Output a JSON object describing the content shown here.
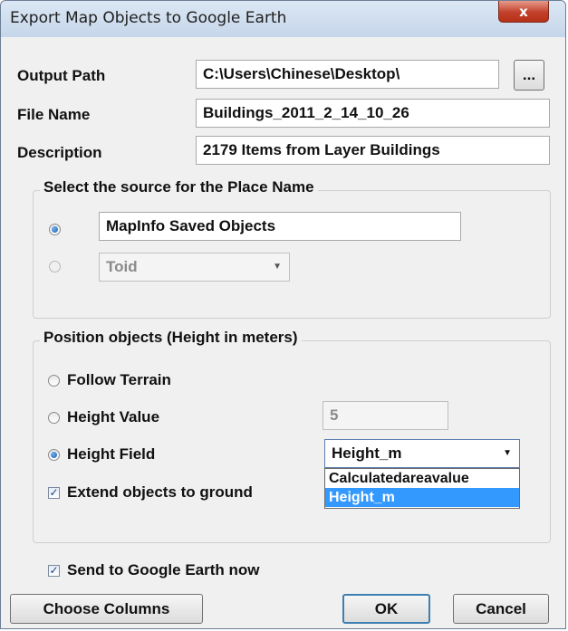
{
  "window": {
    "title": "Export Map Objects to Google Earth",
    "close_glyph": "x"
  },
  "output_path": {
    "label": "Output Path",
    "value": "C:\\Users\\Chinese\\Desktop\\",
    "browse_label": "..."
  },
  "file_name": {
    "label": "File Name",
    "value": "Buildings_2011_2_14_10_26"
  },
  "description": {
    "label": "Description",
    "value": "2179 Items from Layer Buildings"
  },
  "place_name_group": {
    "title": "Select the source for the Place Name",
    "option1_value": "MapInfo Saved Objects",
    "option2_value": "Toid",
    "selected": "option1"
  },
  "position_group": {
    "title": "Position objects (Height in meters)",
    "follow_terrain_label": "Follow Terrain",
    "height_value_label": "Height Value",
    "height_value": "5",
    "height_field_label": "Height Field",
    "height_field_selected": "Height_m",
    "height_field_options": [
      "Calculatedareavalue",
      "Height_m"
    ],
    "extend_label": "Extend objects to ground",
    "extend_checked": true,
    "selected": "height_field"
  },
  "send_now": {
    "label": "Send to Google Earth now",
    "checked": true
  },
  "buttons": {
    "choose_columns": "Choose Columns",
    "ok": "OK",
    "cancel": "Cancel"
  },
  "colors": {
    "selection": "#3399ff",
    "close": "#c2402a"
  }
}
